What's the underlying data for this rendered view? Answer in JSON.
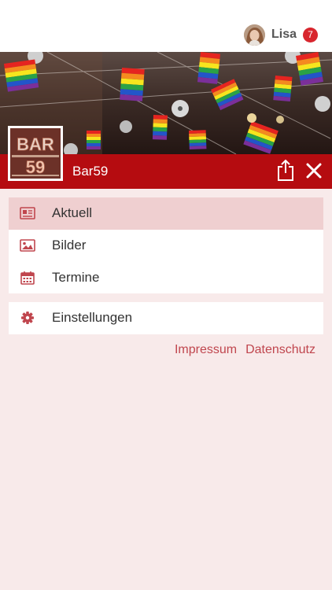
{
  "header": {
    "user_name": "Lisa",
    "badge_count": "7",
    "avatar_icon": "user-avatar-icon"
  },
  "venue": {
    "name": "Bar59",
    "logo_text_top": "BAR",
    "logo_text_bottom": "59"
  },
  "menu": {
    "items": [
      {
        "label": "Aktuell",
        "icon": "newspaper-icon",
        "active": true
      },
      {
        "label": "Bilder",
        "icon": "image-icon",
        "active": false
      },
      {
        "label": "Termine",
        "icon": "calendar-icon",
        "active": false
      }
    ],
    "settings": {
      "label": "Einstellungen",
      "icon": "gear-icon"
    }
  },
  "footer_links": {
    "impressum": "Impressum",
    "datenschutz": "Datenschutz"
  },
  "colors": {
    "accent": "#b50c10",
    "active_bg": "#efcfd0",
    "page_bg": "#f8eaea",
    "link": "#c0464e",
    "badge": "#d8262e"
  }
}
